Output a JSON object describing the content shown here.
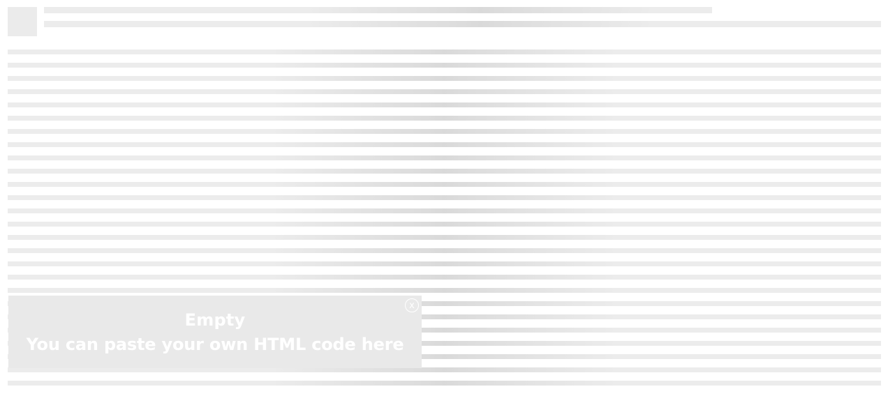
{
  "popup": {
    "title": "Empty",
    "message": "You can paste your own HTML code here",
    "close_label": "x"
  },
  "skeleton": {
    "body_line_count": 26
  },
  "colors": {
    "skeleton": "#ececec",
    "skeleton_highlight": "#d9d9d9",
    "popup_background": "#e9e9e9",
    "popup_text": "#ffffff"
  }
}
